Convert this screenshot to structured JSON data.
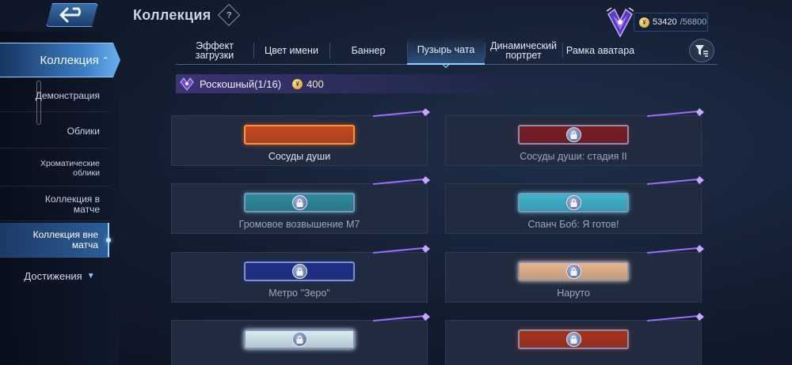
{
  "header": {
    "title": "Коллекция",
    "help_symbol": "?"
  },
  "currency": {
    "current": "53420",
    "max": "/56800",
    "accent": "#c99528"
  },
  "sidebar": {
    "main_label": "Коллекция",
    "items": [
      {
        "label": "Демонстрация"
      },
      {
        "label": "Облики"
      },
      {
        "label": "Хроматические облики"
      },
      {
        "label": "Коллекция в матче"
      },
      {
        "label": "Коллекция вне матча"
      }
    ],
    "achievements_label": "Достижения"
  },
  "tabs": [
    {
      "label": "Эффект загрузки"
    },
    {
      "label": "Цвет имени"
    },
    {
      "label": "Баннер"
    },
    {
      "label": "Пузырь чата"
    },
    {
      "label": "Динамический портрет"
    },
    {
      "label": "Рамка аватара"
    }
  ],
  "category": {
    "label": "Роскошный(1/16)",
    "price": "400",
    "accent": "#8a5cff"
  },
  "items": [
    {
      "name": "Сосуды души",
      "owned": true,
      "color": "#c8461e"
    },
    {
      "name": "Сосуды души: стадия II",
      "owned": false,
      "color": "#7a1b22"
    },
    {
      "name": "Громовое возвышение M7",
      "owned": false,
      "color": "#2d8a9a"
    },
    {
      "name": "Спанч Боб: Я готов!",
      "owned": false,
      "color": "#3fb3cc"
    },
    {
      "name": "Метро \"Зеро\"",
      "owned": false,
      "color": "#1f2e8a"
    },
    {
      "name": "Наруто",
      "owned": false,
      "color": "#e9b58c"
    },
    {
      "name": "",
      "owned": false,
      "color": "#d9ecf2"
    },
    {
      "name": "",
      "owned": false,
      "color": "#a8321c"
    }
  ]
}
